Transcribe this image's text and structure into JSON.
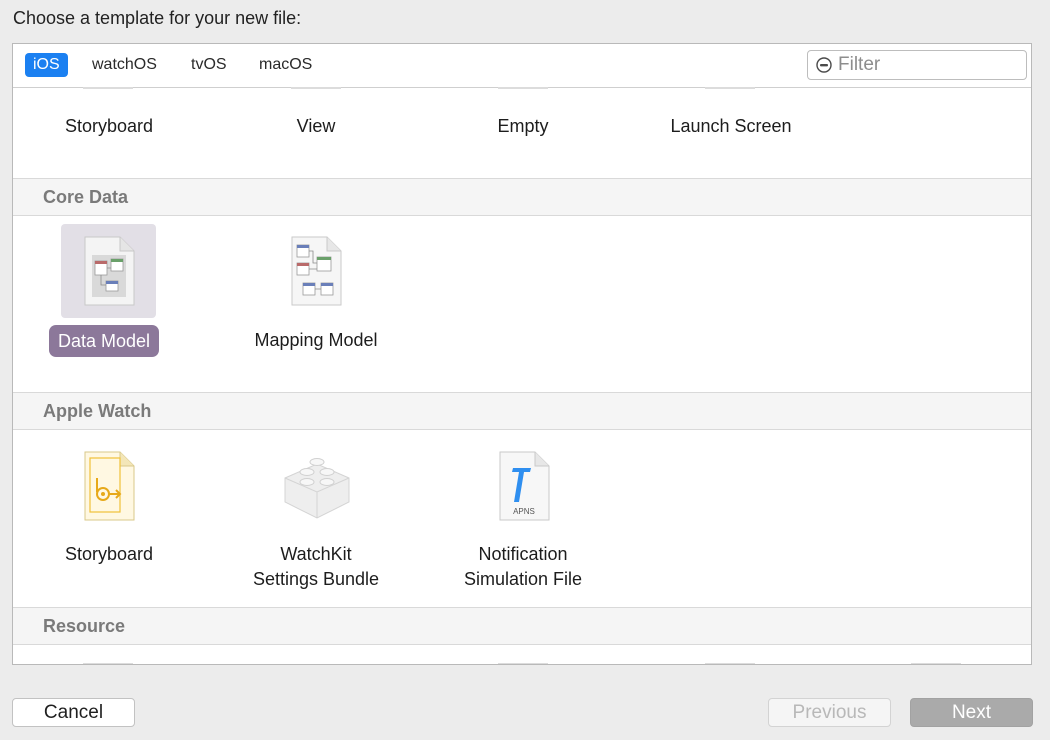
{
  "dialog": {
    "title": "Choose a template for your new file:"
  },
  "tabs": [
    {
      "label": "iOS",
      "active": true
    },
    {
      "label": "watchOS",
      "active": false
    },
    {
      "label": "tvOS",
      "active": false
    },
    {
      "label": "macOS",
      "active": false
    }
  ],
  "filter": {
    "placeholder": "Filter",
    "value": ""
  },
  "user_interface": {
    "items": [
      "Storyboard",
      "View",
      "Empty",
      "Launch Screen"
    ]
  },
  "core_data": {
    "header": "Core Data",
    "items": [
      "Data Model",
      "Mapping Model"
    ],
    "selected": "Data Model"
  },
  "apple_watch": {
    "header": "Apple Watch",
    "items": [
      {
        "line1": "Storyboard",
        "line2": ""
      },
      {
        "line1": "WatchKit",
        "line2": "Settings Bundle"
      },
      {
        "line1": "Notification",
        "line2": "Simulation File"
      }
    ],
    "apns_label": "APNS"
  },
  "resource": {
    "header": "Resource"
  },
  "buttons": {
    "cancel": "Cancel",
    "previous": "Previous",
    "next": "Next"
  },
  "colors": {
    "accent": "#1b80f1",
    "selection": "#8c789a",
    "selection_tile": "#e2dfe6"
  }
}
